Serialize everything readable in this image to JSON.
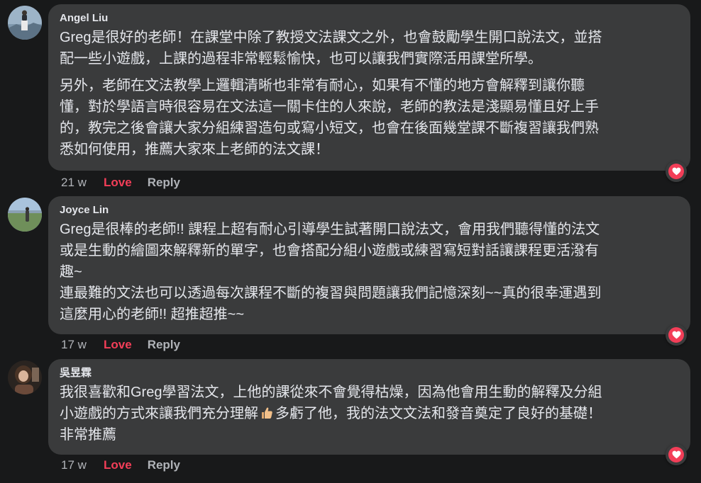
{
  "colors": {
    "background": "#18191a",
    "bubble": "#3a3b3c",
    "text": "#e4e6eb",
    "muted": "#b0b3b8",
    "love": "#f33e58"
  },
  "comments": [
    {
      "author": "Angel Liu",
      "avatar_icon": "avatar-landscape-icon",
      "paragraphs": [
        "Greg是很好的老師！在課堂中除了教授文法課文之外，也會鼓勵學生開口說法文，並搭\n配一些小遊戲，上課的過程非常輕鬆愉快，也可以讓我們實際活用課堂所學。",
        "另外，老師在文法教學上邏輯清晰也非常有耐心，如果有不懂的地方會解釋到讓你聽\n懂，對於學語言時很容易在文法這一關卡住的人來說，老師的教法是淺顯易懂且好上手\n的，教完之後會讓大家分組練習造句或寫小短文，也會在後面幾堂課不斷複習讓我們熟\n悉如何使用，推薦大家來上老師的法文課！"
      ],
      "time": "21 w",
      "love_label": "Love",
      "reply_label": "Reply",
      "reaction_icon": "heart-icon"
    },
    {
      "author": "Joyce Lin",
      "avatar_icon": "avatar-field-icon",
      "paragraphs": [
        "Greg是很棒的老師!! 課程上超有耐心引導學生試著開口說法文，會用我們聽得懂的法文\n或是生動的繪圖來解釋新的單字，也會搭配分組小遊戲或練習寫短對話讓課程更活潑有\n趣~\n連最難的文法也可以透過每次課程不斷的複習與問題讓我們記憶深刻~~真的很幸運遇到\n這麼用心的老師!! 超推超推~~"
      ],
      "time": "17 w",
      "love_label": "Love",
      "reply_label": "Reply",
      "reaction_icon": "heart-icon"
    },
    {
      "author": "吳昱霖",
      "avatar_icon": "avatar-person-icon",
      "line1": "我很喜歡和Greg學習法文，上他的課從來不會覺得枯燥，因為他會用生動的解釋及分組",
      "line2_before": "小遊戲的方式來讓我們充分理解",
      "line2_emoji": "thumbs-up-icon",
      "line2_after": "多虧了他，我的法文文法和發音奠定了良好的基礎！",
      "line3": "非常推薦",
      "time": "17 w",
      "love_label": "Love",
      "reply_label": "Reply",
      "reaction_icon": "heart-icon"
    }
  ]
}
